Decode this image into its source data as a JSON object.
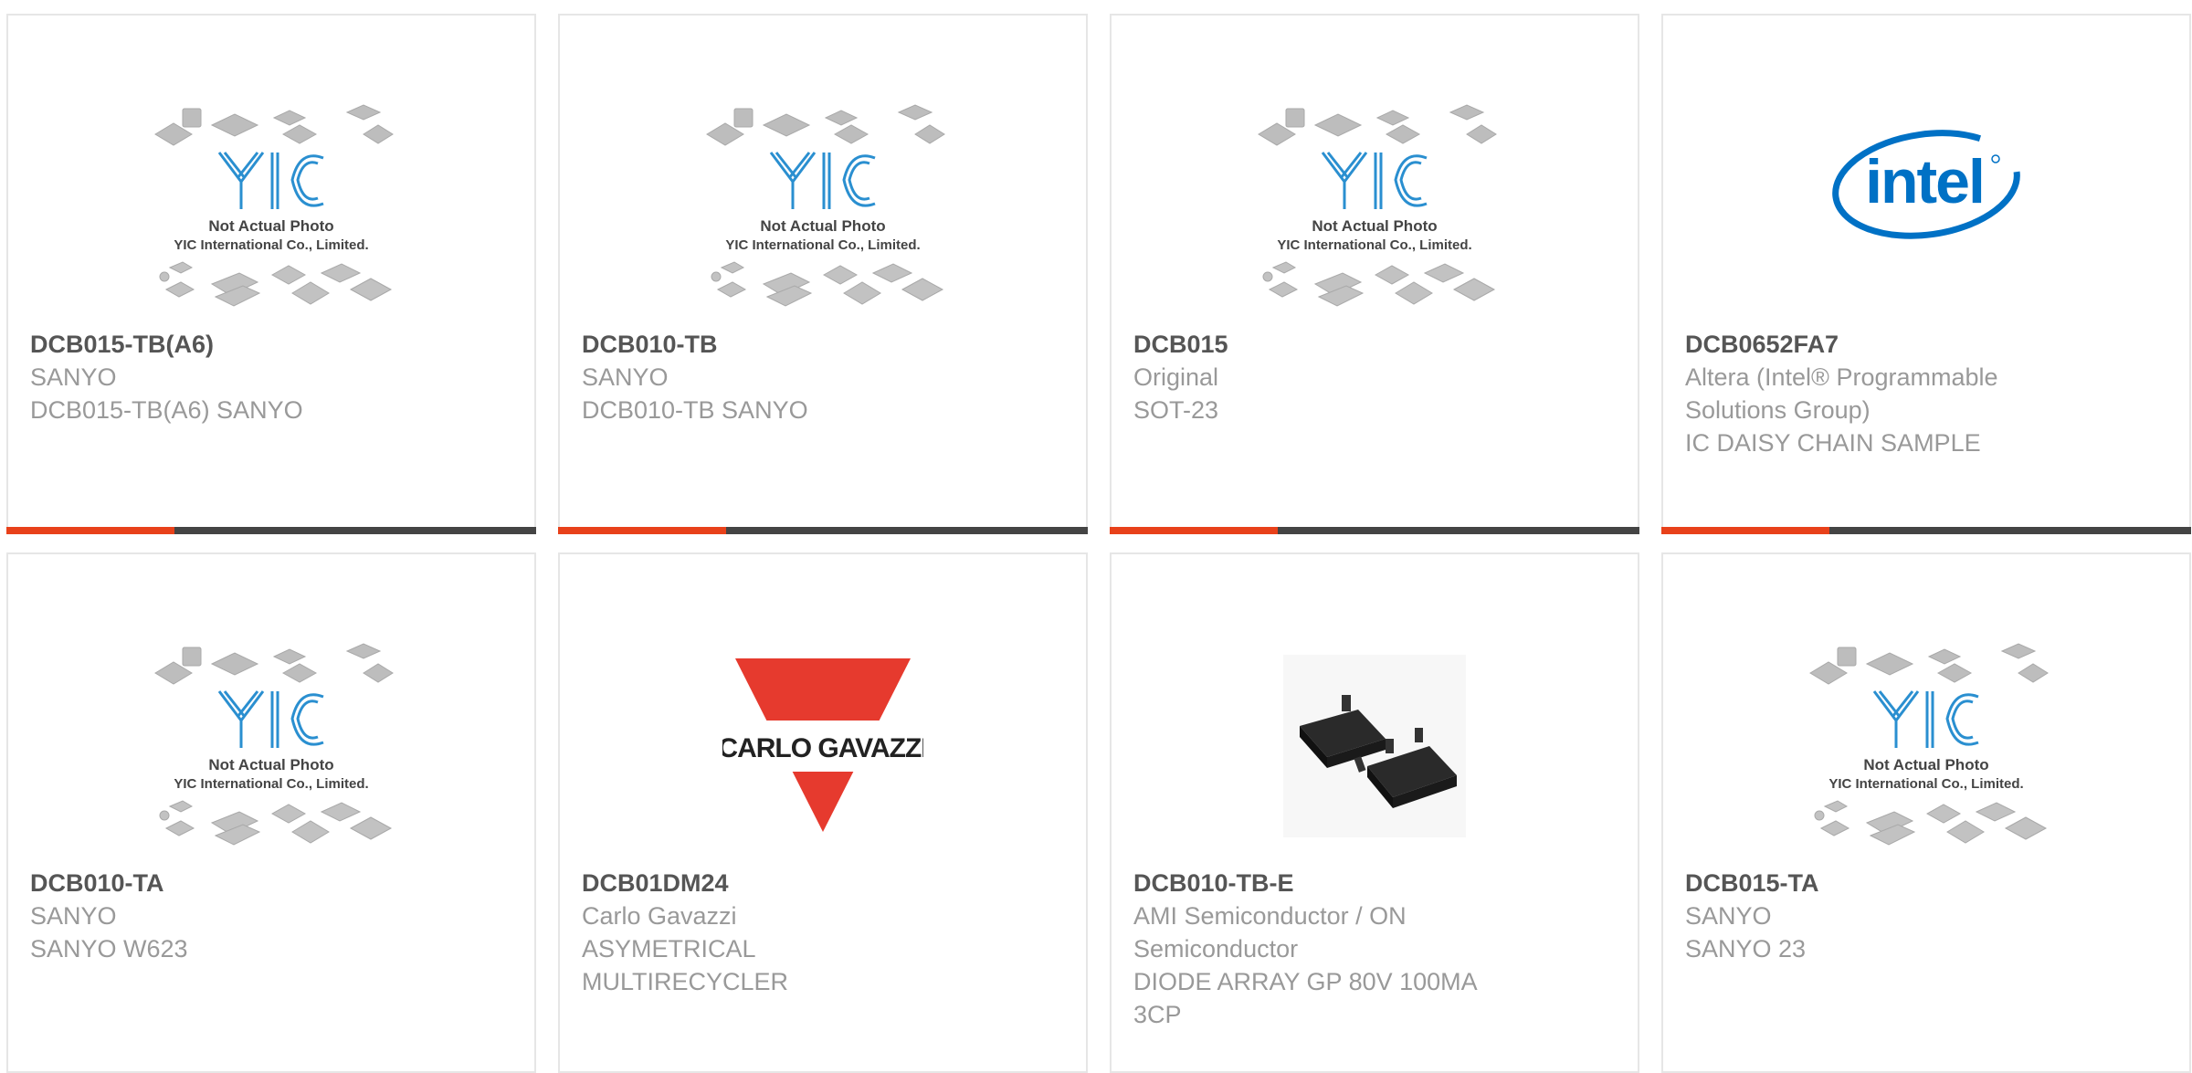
{
  "colors": {
    "accent": "#e8411a",
    "bar": "#444444",
    "text": "#999999",
    "title": "#555555",
    "card_border": "#e6e6e6",
    "yic_blue": "#2a8fd0",
    "intel_blue": "#0071c5",
    "gavazzi_red": "#e63a2e"
  },
  "placeholder": {
    "line1": "Not Actual Photo",
    "line2": "YIC International Co., Limited."
  },
  "logos": {
    "carlo_gavazzi": "CARLO GAVAZZI",
    "intel": "intel"
  },
  "products": [
    {
      "part": "DCB015-TB(A6)",
      "maker": "SANYO",
      "desc": "DCB015-TB(A6) SANYO",
      "image": "yic-placeholder",
      "accent_bar": true
    },
    {
      "part": "DCB010-TB",
      "maker": "SANYO",
      "desc": "DCB010-TB SANYO",
      "image": "yic-placeholder",
      "accent_bar": true
    },
    {
      "part": "DCB015",
      "maker": "Original",
      "desc": "SOT-23",
      "image": "yic-placeholder",
      "accent_bar": true
    },
    {
      "part": "DCB0652FA7",
      "maker": "Altera (Intel® Programmable Solutions Group)",
      "desc": "IC DAISY CHAIN SAMPLE",
      "image": "intel-logo",
      "accent_bar": true
    },
    {
      "part": "DCB010-TA",
      "maker": "SANYO",
      "desc": "SANYO W623",
      "image": "yic-placeholder",
      "accent_bar": false
    },
    {
      "part": "DCB01DM24",
      "maker": "Carlo Gavazzi",
      "desc": "ASYMETRICAL MULTIRECYCLER",
      "image": "carlo-gavazzi-logo",
      "accent_bar": false
    },
    {
      "part": "DCB010-TB-E",
      "maker": "AMI Semiconductor / ON Semiconductor",
      "desc": "DIODE ARRAY GP 80V 100MA 3CP",
      "image": "sot23-package-photo",
      "accent_bar": false
    },
    {
      "part": "DCB015-TA",
      "maker": "SANYO",
      "desc": "SANYO 23",
      "image": "yic-placeholder",
      "accent_bar": false
    }
  ]
}
